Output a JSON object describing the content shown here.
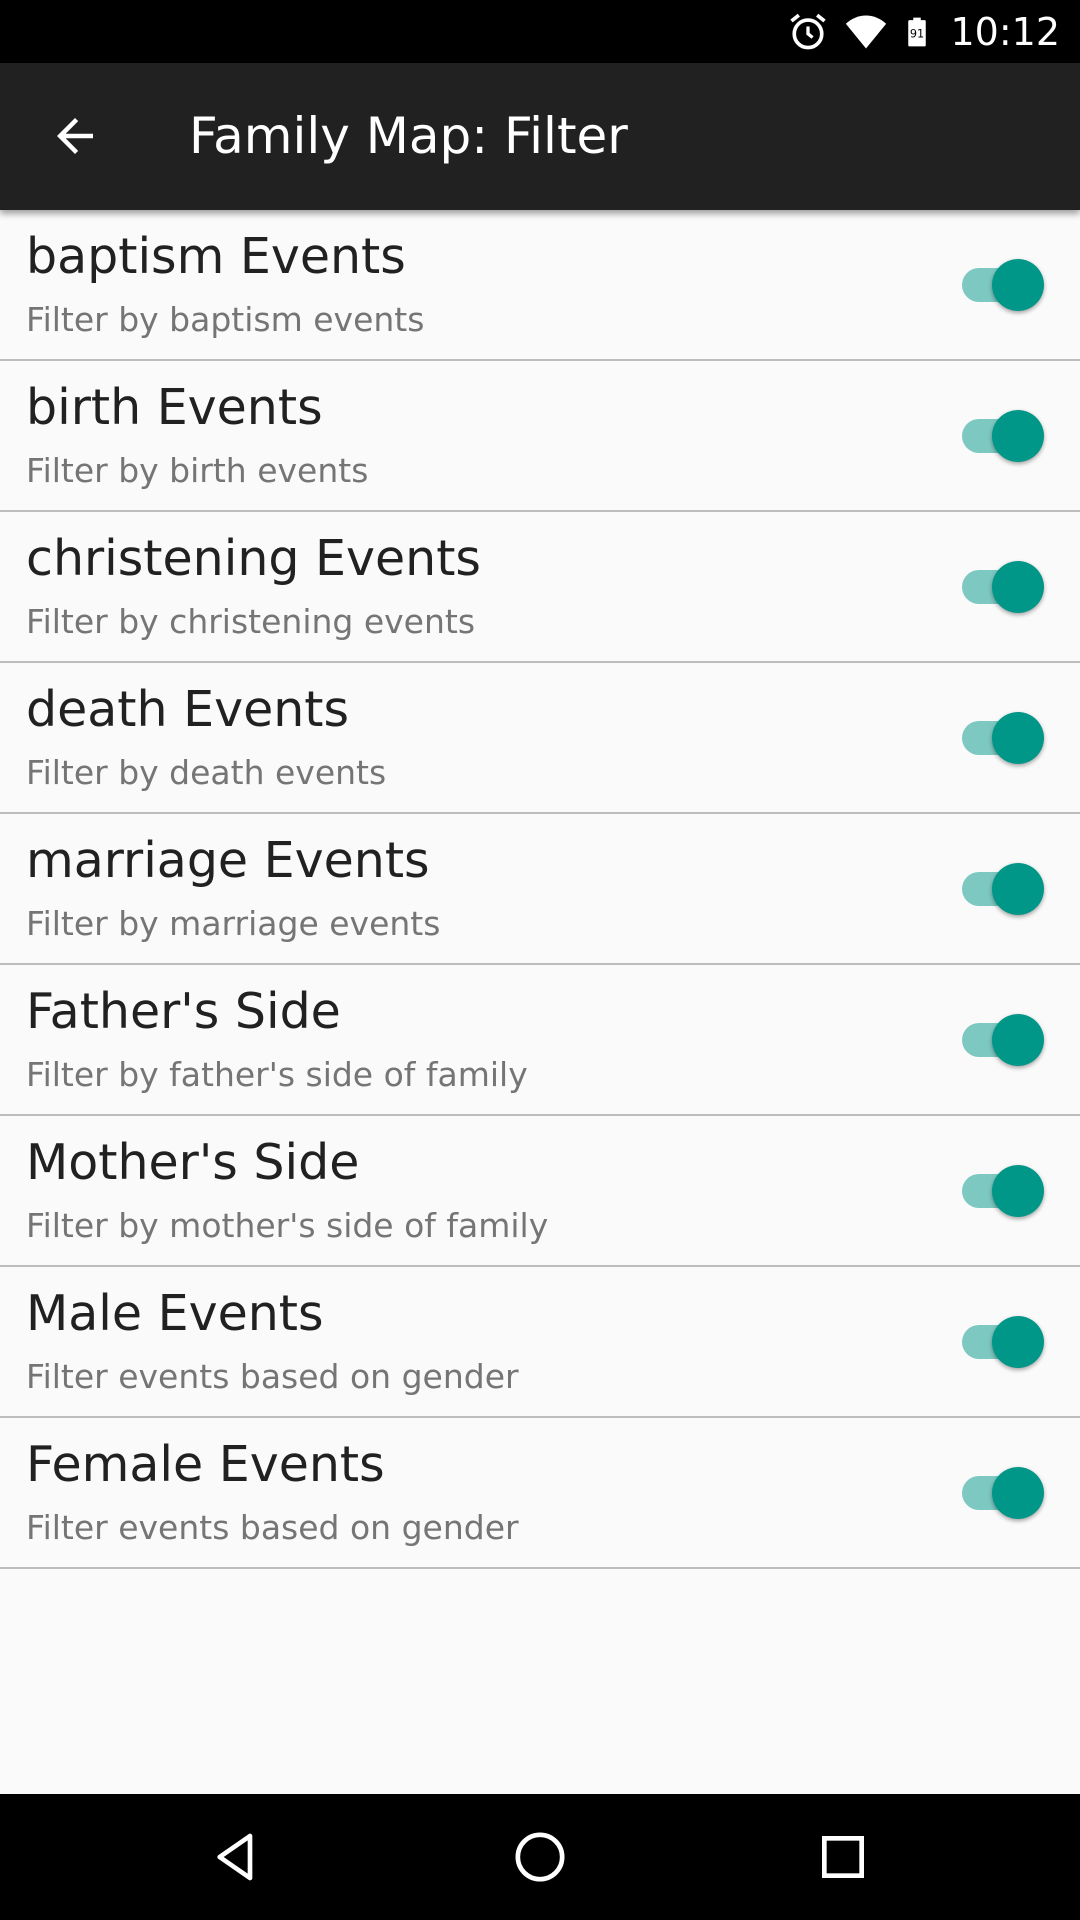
{
  "status_bar": {
    "time": "10:12",
    "battery_level": "91",
    "icons": [
      "alarm-icon",
      "wifi-icon",
      "battery-icon"
    ]
  },
  "app_bar": {
    "title": "Family Map: Filter",
    "back_icon": "arrow-back-icon"
  },
  "colors": {
    "accent": "#009688",
    "track": "#80cbc4",
    "app_bar": "#212121",
    "background": "#fafafa"
  },
  "filters": [
    {
      "title": "baptism Events",
      "subtitle": "Filter by baptism events",
      "enabled": true
    },
    {
      "title": "birth Events",
      "subtitle": "Filter by birth events",
      "enabled": true
    },
    {
      "title": "christening Events",
      "subtitle": "Filter by christening events",
      "enabled": true
    },
    {
      "title": "death Events",
      "subtitle": "Filter by death events",
      "enabled": true
    },
    {
      "title": "marriage Events",
      "subtitle": "Filter by marriage events",
      "enabled": true
    },
    {
      "title": "Father's Side",
      "subtitle": "Filter by father's side of family",
      "enabled": true
    },
    {
      "title": "Mother's Side",
      "subtitle": "Filter by mother's side of family",
      "enabled": true
    },
    {
      "title": "Male Events",
      "subtitle": "Filter events based on gender",
      "enabled": true
    },
    {
      "title": "Female Events",
      "subtitle": "Filter events based on gender",
      "enabled": true
    }
  ],
  "nav_bar": {
    "buttons": [
      "back-triangle-icon",
      "home-circle-icon",
      "recents-square-icon"
    ]
  }
}
